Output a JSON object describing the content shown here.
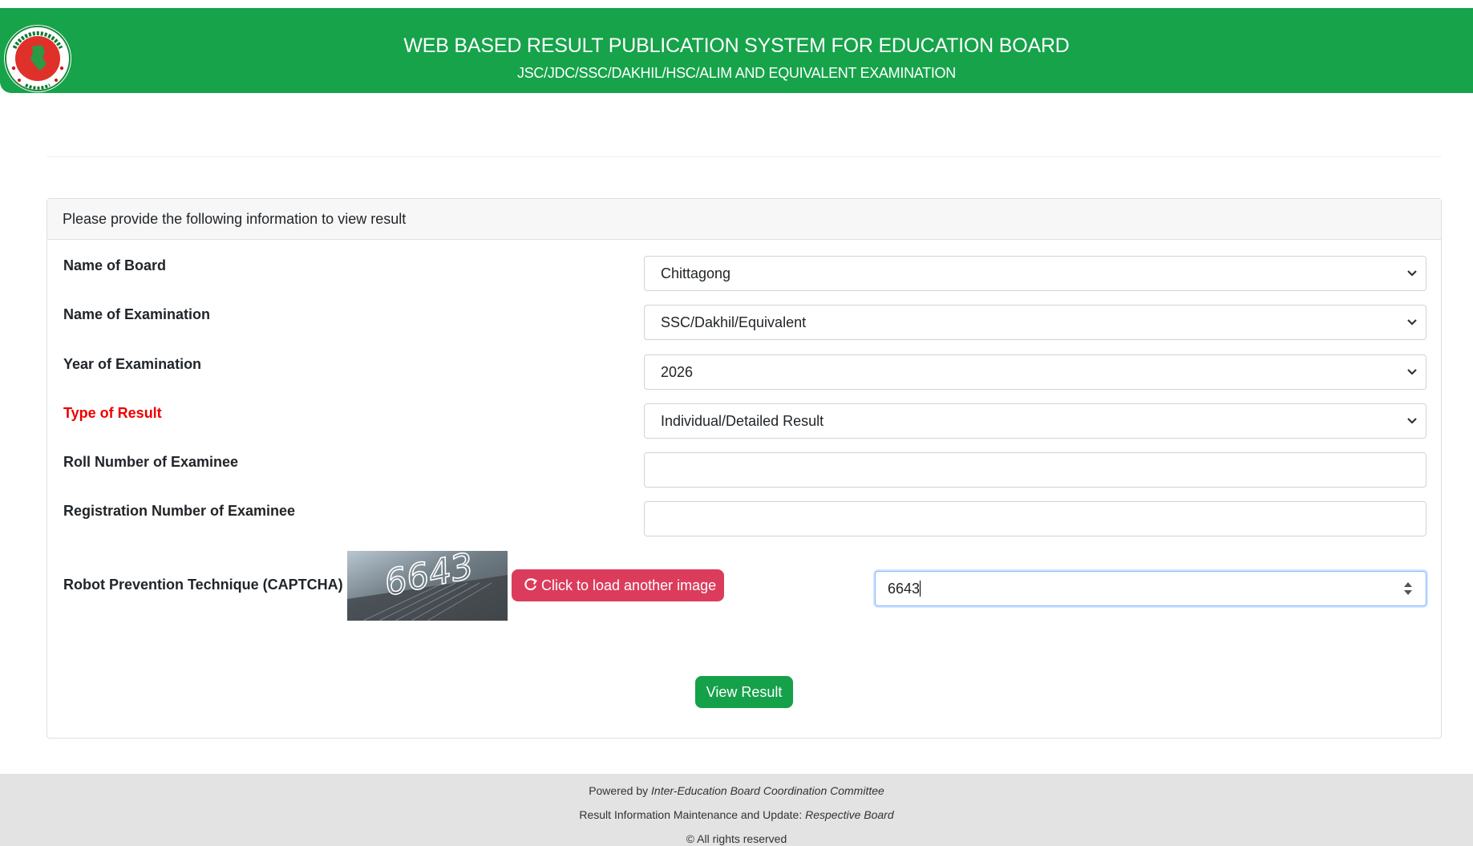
{
  "header": {
    "title": "WEB BASED RESULT PUBLICATION SYSTEM FOR EDUCATION BOARD",
    "subtitle": "JSC/JDC/SSC/DAKHIL/HSC/ALIM AND EQUIVALENT EXAMINATION",
    "logo_icon": "government-seal-logo"
  },
  "form": {
    "heading": "Please provide the following information to view result",
    "fields": {
      "board": {
        "label": "Name of Board",
        "value": "Chittagong"
      },
      "exam": {
        "label": "Name of Examination",
        "value": "SSC/Dakhil/Equivalent"
      },
      "year": {
        "label": "Year of Examination",
        "value": "2026"
      },
      "result_type": {
        "label": "Type of Result",
        "value": "Individual/Detailed Result",
        "label_color": "#ee0000"
      },
      "roll": {
        "label": "Roll Number of Examinee",
        "value": ""
      },
      "registration": {
        "label": "Registration Number of Examinee",
        "value": ""
      }
    },
    "captcha": {
      "label": "Robot Prevention Technique (CAPTCHA)",
      "image_text": "6643",
      "reload_label": "Click to load another image",
      "reload_icon": "refresh-icon",
      "input_value": "6643"
    },
    "submit_label": "View Result"
  },
  "footer": {
    "powered_prefix": "Powered by ",
    "powered_by": "Inter-Education Board Coordination Committee",
    "maintenance_prefix": "Result Information Maintenance and Update: ",
    "maintenance_by": "Respective Board",
    "rights": "© All rights reserved"
  },
  "colors": {
    "header_bg": "#16a34a",
    "reload_button": "#dc3c5b",
    "submit_button": "#15a04a",
    "footer_bg": "#e3e3e3"
  }
}
